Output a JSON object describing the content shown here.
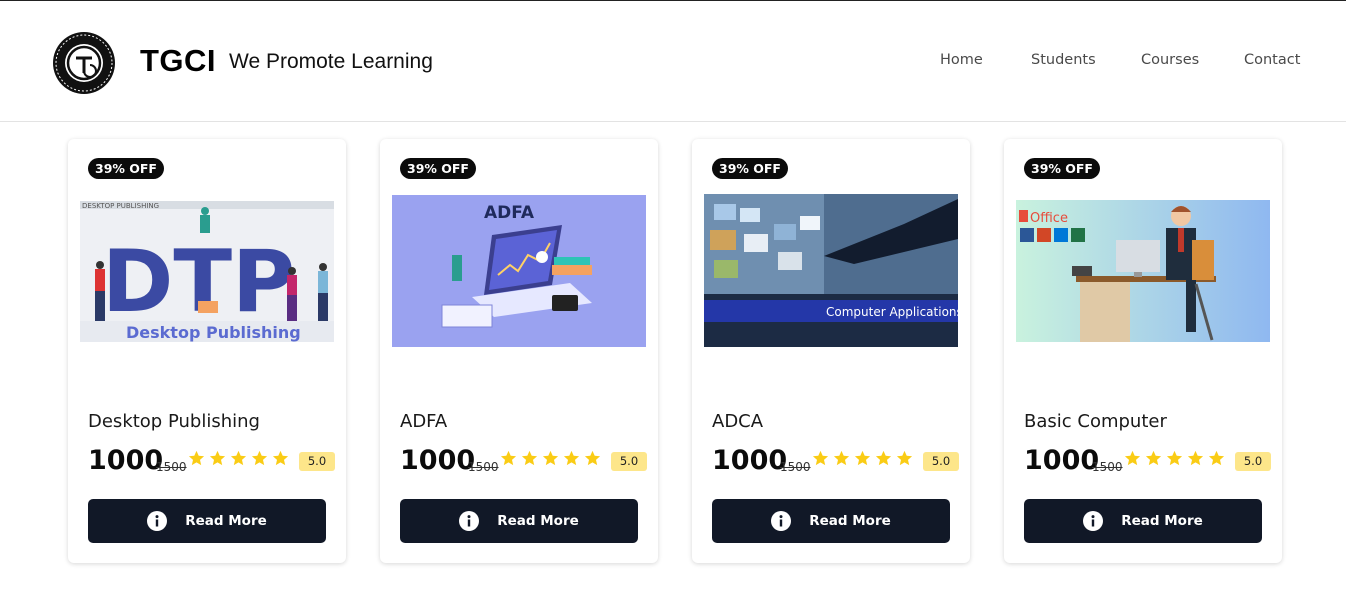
{
  "header": {
    "brand": "TGCI",
    "tagline": "We Promote Learning",
    "logo_icon": "tgci-logo-seal",
    "logo_text": "TECHNO GRAM COMPUTER INSTITUTE",
    "nav": [
      "Home",
      "Students",
      "Courses",
      "Contact"
    ]
  },
  "courses": [
    {
      "badge": "39% OFF",
      "title": "Desktop Publishing",
      "price": "1000",
      "old_price": "1500",
      "stars": 5,
      "rating": "5.0",
      "button": "Read More",
      "image_text": [
        "DESKTOP PUBLISHING",
        "DTP",
        "Desktop Publishing"
      ]
    },
    {
      "badge": "39% OFF",
      "title": "ADFA",
      "price": "1000",
      "old_price": "1500",
      "stars": 5,
      "rating": "5.0",
      "button": "Read More",
      "image_text": [
        "ADFA"
      ]
    },
    {
      "badge": "39% OFF",
      "title": "ADCA",
      "price": "1000",
      "old_price": "1500",
      "stars": 5,
      "rating": "5.0",
      "button": "Read More",
      "image_text": [
        "Computer Applications"
      ]
    },
    {
      "badge": "39% OFF",
      "title": "Basic Computer",
      "price": "1000",
      "old_price": "1500",
      "stars": 5,
      "rating": "5.0",
      "button": "Read More",
      "image_text": [
        "Office"
      ]
    }
  ],
  "colors": {
    "button_bg": "#111827",
    "badge_bg": "#0b0b0b",
    "star": "#facc15",
    "rating_bg": "#fde68a"
  }
}
